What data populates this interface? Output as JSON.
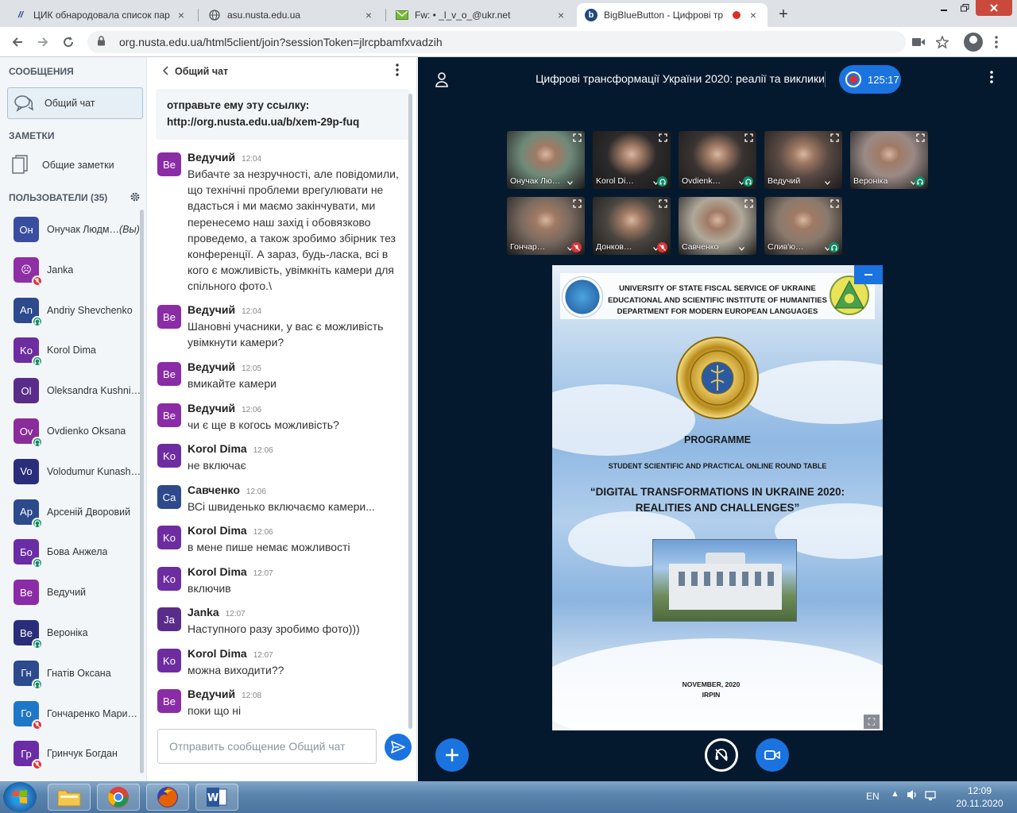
{
  "browser": {
    "tabs": [
      {
        "title": "ЦИК обнародовала список пар",
        "favicon": "n-logo",
        "active": false
      },
      {
        "title": "asu.nusta.edu.ua",
        "favicon": "globe-icon",
        "active": false
      },
      {
        "title": "Fw: • _l_v_o_@ukr.net",
        "favicon": "mail-icon",
        "active": false
      },
      {
        "title": "BigBlueButton - Цифрові тр",
        "favicon": "bbb-icon",
        "active": true
      }
    ],
    "close_glyph": "×",
    "new_tab_glyph": "+",
    "url": "org.nusta.edu.ua/html5client/join?sessionToken=jlrcpbamfxvadzih"
  },
  "sidebar": {
    "messages_header": "СООБЩЕНИЯ",
    "public_chat": "Общий чат",
    "notes_header": "ЗАМЕТКИ",
    "shared_notes": "Общие заметки",
    "users_header": "ПОЛЬЗОВАТЕЛИ (35)",
    "you_label": "(Вы)",
    "users": [
      {
        "initials": "Он",
        "name": "Онучак Людм…",
        "color": "#3a4ea0",
        "status": "none",
        "you": true
      },
      {
        "initials": "☹",
        "name": "Janka",
        "color": "#8e2fa6",
        "status": "muted"
      },
      {
        "initials": "An",
        "name": "Andriy Shevchenko",
        "color": "#2c4a8c",
        "status": "listen"
      },
      {
        "initials": "Ko",
        "name": "Korol Dima",
        "color": "#6d2da0",
        "status": "listen"
      },
      {
        "initials": "Ol",
        "name": "Oleksandra Kushnir…",
        "color": "#5a2c8a",
        "status": "none"
      },
      {
        "initials": "Ov",
        "name": "Ovdienko Oksana",
        "color": "#8a2c9a",
        "status": "listen"
      },
      {
        "initials": "Vo",
        "name": "Volodumur Kunash…",
        "color": "#2a2e7a",
        "status": "none"
      },
      {
        "initials": "Ар",
        "name": "Арсеній Дворовий",
        "color": "#2c4a8c",
        "status": "listen"
      },
      {
        "initials": "Бо",
        "name": "Бова Анжела",
        "color": "#6a2da6",
        "status": "listen"
      },
      {
        "initials": "Ве",
        "name": "Ведучий",
        "color": "#8a2ca6",
        "status": "none"
      },
      {
        "initials": "Ве",
        "name": "Вероніка",
        "color": "#2a2e7a",
        "status": "listen"
      },
      {
        "initials": "Гн",
        "name": "Гнатів Оксана",
        "color": "#2c4a8c",
        "status": "listen"
      },
      {
        "initials": "Го",
        "name": "Гончаренко Мари…",
        "color": "#1f77c8",
        "status": "muted"
      },
      {
        "initials": "Гр",
        "name": "Гринчук Богдан",
        "color": "#6a2da6",
        "status": "muted"
      }
    ]
  },
  "chat": {
    "title": "Общий чат",
    "welcome_line1": "отправьте ему эту ссылку:",
    "welcome_link": "http://org.nusta.edu.ua/b/xem-29p-fuq",
    "messages": [
      {
        "initials": "Ве",
        "author": "Ведучий",
        "time": "12:04",
        "color": "#8a2ca6",
        "text": "Вибачте за незручності, але повідомили, що технічні проблеми врегулювати не вдасться і ми маємо закінчувати, ми перенесемо наш захід і обовязково проведемо, а також зробимо збірник тез конференції. А зараз, будь-ласка, всі в кого є можливість, увімкніть камери для спільного фото.\\"
      },
      {
        "initials": "Ве",
        "author": "Ведучий",
        "time": "12:04",
        "color": "#8a2ca6",
        "text": "Шановні учасники, у вас є можливість увімкнути камери?"
      },
      {
        "initials": "Ве",
        "author": "Ведучий",
        "time": "12:05",
        "color": "#8a2ca6",
        "text": "вмикайте камери"
      },
      {
        "initials": "Ве",
        "author": "Ведучий",
        "time": "12:06",
        "color": "#8a2ca6",
        "text": "чи є ще в когось можливість?"
      },
      {
        "initials": "Ko",
        "author": "Korol Dima",
        "time": "12:06",
        "color": "#6d2da0",
        "text": "не включає"
      },
      {
        "initials": "Са",
        "author": "Савченко",
        "time": "12:06",
        "color": "#2c4a8c",
        "text": "ВСі швиденько включаємо камери..."
      },
      {
        "initials": "Ko",
        "author": "Korol Dima",
        "time": "12:06",
        "color": "#6d2da0",
        "text": "в мене пише немає можливості"
      },
      {
        "initials": "Ko",
        "author": "Korol Dima",
        "time": "12:07",
        "color": "#6d2da0",
        "text": "включив"
      },
      {
        "initials": "Ja",
        "author": "Janka",
        "time": "12:07",
        "color": "#5a2c8a",
        "text": "Наступного разу зробимо фото)))"
      },
      {
        "initials": "Ko",
        "author": "Korol Dima",
        "time": "12:07",
        "color": "#6d2da0",
        "text": "можна виходити??"
      },
      {
        "initials": "Ве",
        "author": "Ведучий",
        "time": "12:08",
        "color": "#8a2ca6",
        "text": "поки що ні"
      }
    ],
    "input_placeholder": "Отправить сообщение Общий чат"
  },
  "meeting": {
    "title": "Цифрові трансформації України 2020: реалії та виклики",
    "recording_time": "125:17",
    "videos": [
      {
        "label": "Онучак Лю…",
        "status": "none",
        "bg": "#6f8a7a"
      },
      {
        "label": "Korol Di…",
        "status": "listen",
        "bg": "#2c2a2a"
      },
      {
        "label": "Ovdienk…",
        "status": "listen",
        "bg": "#3a3432"
      },
      {
        "label": "Ведучий",
        "status": "none",
        "bg": "#5a4a44"
      },
      {
        "label": "Вероніка",
        "status": "listen",
        "bg": "#9a8a86"
      },
      {
        "label": "Гончар…",
        "status": "muted",
        "bg": "#7a6a60"
      },
      {
        "label": "Донков…",
        "status": "muted",
        "bg": "#4a4640"
      },
      {
        "label": "Савченко",
        "status": "none",
        "bg": "#b0a89a"
      },
      {
        "label": "Слив'ю…",
        "status": "listen",
        "bg": "#8a7a6e"
      }
    ],
    "slide": {
      "header_lines": [
        "UNIVERSITY OF STATE FISCAL SERVICE OF UKRAINE",
        "EDUCATIONAL AND SCIENTIFIC INSTITUTE OF HUMANITIES",
        "DEPARTMENT FOR MODERN EUROPEAN LANGUAGES"
      ],
      "programme": "PROGRAMME",
      "subtitle": "STUDENT SCIENTIFIC AND PRACTICAL ONLINE ROUND TABLE",
      "big_title_1": "“DIGITAL TRANSFORMATIONS IN UKRAINE 2020:",
      "big_title_2": "REALITIES AND CHALLENGES”",
      "footer_1": "NOVEMBER, 2020",
      "footer_2": "IRPIN"
    }
  },
  "taskbar": {
    "lang": "EN",
    "time": "12:09",
    "date": "20.11.2020",
    "apps": [
      "folder-icon",
      "chrome-icon",
      "firefox-icon",
      "word-icon"
    ]
  },
  "colors": {
    "accent_blue": "#1b73e0",
    "presentation_bg": "#05192e",
    "muted_red": "#e0323a",
    "listen_green": "#0f8a65"
  }
}
